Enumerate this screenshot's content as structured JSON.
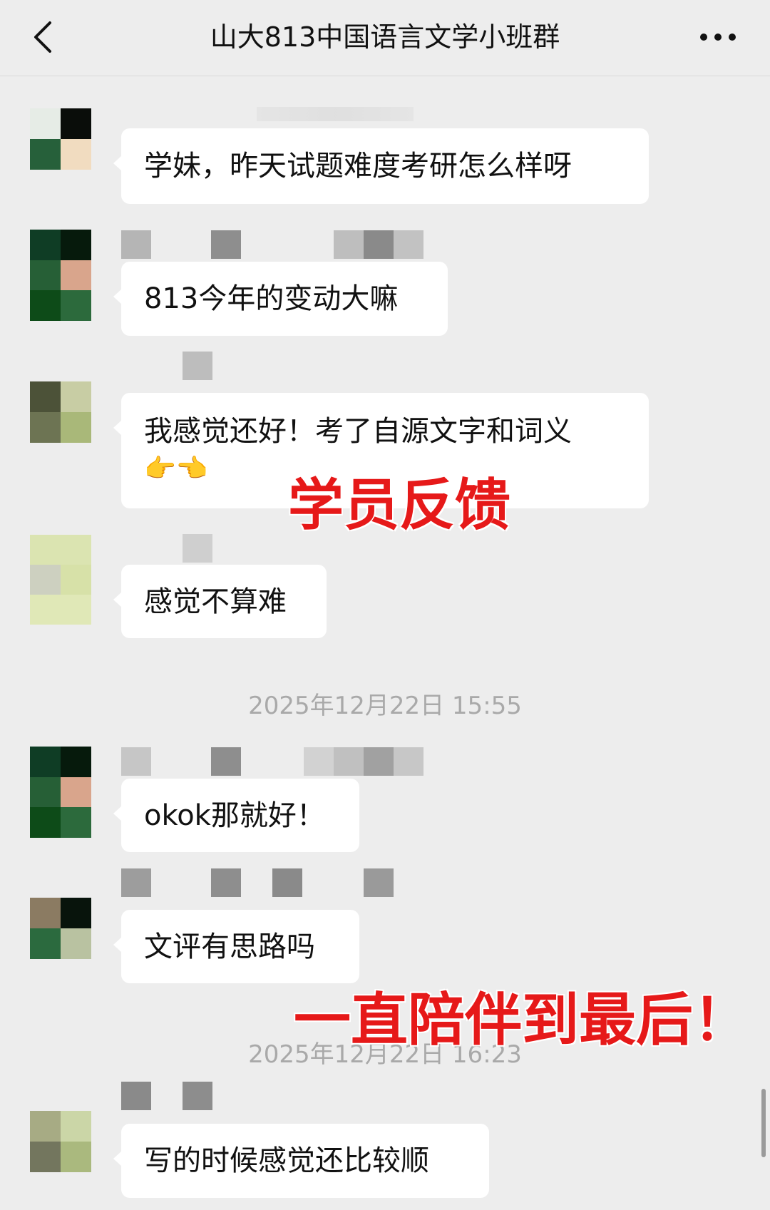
{
  "header": {
    "back_icon": "chevron-left-icon",
    "title": "山大813中国语言文学小班群",
    "more_icon": "more-dots-icon"
  },
  "messages": [
    {
      "text": "学妹，昨天试题难度考研怎么样呀",
      "avatar_colors": [
        "#e6ece6",
        "#0a0d0a",
        "#26603a",
        "#f1dcc0"
      ]
    },
    {
      "text": "813今年的变动大嘛",
      "avatar_colors": [
        "#0f3d25",
        "#061a0c",
        "#265f36",
        "#d9a58c",
        "#0d4b18",
        "#2c6a3c"
      ]
    },
    {
      "text": "我感觉还好！考了自源文字和词义",
      "emoji": "👉👈",
      "avatar_colors": [
        "#4c5238",
        "#c8cda4",
        "#6d7453",
        "#a9b879"
      ]
    },
    {
      "text": "感觉不算难",
      "avatar_colors": [
        "#dbe4b1",
        "#dbe4b1",
        "#cdd0c0",
        "#d7e1a8",
        "#e0e8b7",
        "#e0e8b7"
      ]
    },
    {
      "text": "okok那就好！",
      "avatar_colors": [
        "#0f3d25",
        "#061a0c",
        "#265f36",
        "#d9a58c",
        "#0d4b18",
        "#2c6a3c"
      ]
    },
    {
      "text": "文评有思路吗",
      "avatar_colors": [
        "#8b7b62",
        "#08140c",
        "#2b6a3e",
        "#b9c2a1"
      ]
    },
    {
      "text": "写的时候感觉还比较顺",
      "avatar_colors": [
        "#a7ab84",
        "#cbd6a7",
        "#73765e",
        "#aab97e"
      ]
    }
  ],
  "timestamps": [
    "2025年12月22日 15:55",
    "2025年12月22日 16:23"
  ],
  "overlays": [
    "学员反馈",
    "一直陪伴到最后！"
  ],
  "colors": {
    "background": "#ededed",
    "bubble": "#ffffff",
    "overlay_red": "#e61919"
  }
}
